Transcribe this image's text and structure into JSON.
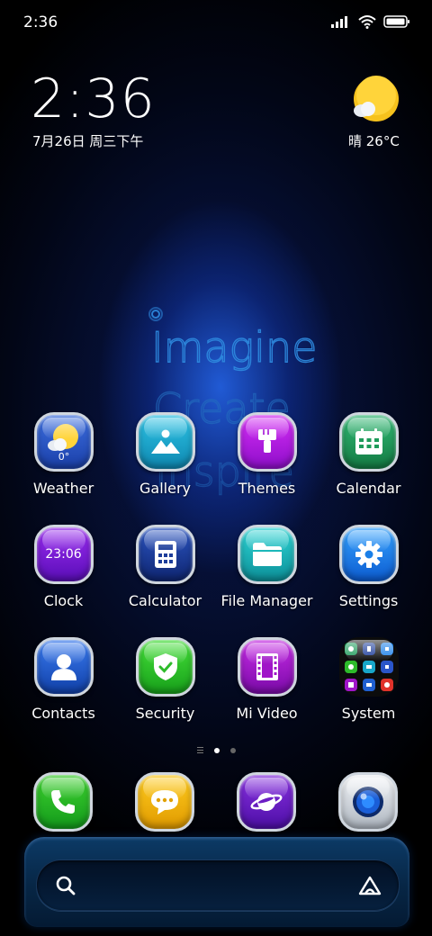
{
  "status_bar": {
    "time": "2:36"
  },
  "clock_widget": {
    "time": "2:36",
    "date": "7月26日 周三下午"
  },
  "weather_widget": {
    "condition_temp": "晴 26°C",
    "icon": "sunny-cloud-icon"
  },
  "wallpaper": {
    "line1": "Imagine",
    "line2": "Create",
    "line3": "Inspire"
  },
  "apps": [
    {
      "label": "Weather",
      "icon": "weather-icon",
      "badge": "0°",
      "color": "#2a55c8"
    },
    {
      "label": "Gallery",
      "icon": "gallery-icon",
      "color": "#18a7c9"
    },
    {
      "label": "Themes",
      "icon": "brush-icon",
      "color": "#b21be6"
    },
    {
      "label": "Calendar",
      "icon": "calendar-icon",
      "color": "#1e9b5a"
    },
    {
      "label": "Clock",
      "icon": "clock-icon",
      "badge": "23:06",
      "color": "#7a19d8"
    },
    {
      "label": "Calculator",
      "icon": "calculator-icon",
      "color": "#1d3d9a"
    },
    {
      "label": "File Manager",
      "icon": "folder-icon",
      "color": "#16b6b8"
    },
    {
      "label": "Settings",
      "icon": "gear-icon",
      "color": "#1a7fe8"
    },
    {
      "label": "Contacts",
      "icon": "contact-icon",
      "color": "#1f5fd0"
    },
    {
      "label": "Security",
      "icon": "shield-icon",
      "color": "#2dbb2a"
    },
    {
      "label": "Mi Video",
      "icon": "film-icon",
      "color": "#a015c8"
    },
    {
      "label": "System",
      "icon": "folder-grid-icon",
      "color": "#111111"
    }
  ],
  "dock": [
    {
      "name": "Phone",
      "icon": "phone-icon",
      "color": "#22b32b"
    },
    {
      "name": "Messages",
      "icon": "message-icon",
      "color": "#f5b300"
    },
    {
      "name": "Browser",
      "icon": "planet-icon",
      "color": "#6c1dc4"
    },
    {
      "name": "Camera",
      "icon": "camera-icon",
      "color": "#c9ced6"
    }
  ],
  "page_indicator": {
    "pages": 2,
    "current": 1
  },
  "search_bar": {
    "placeholder": ""
  }
}
